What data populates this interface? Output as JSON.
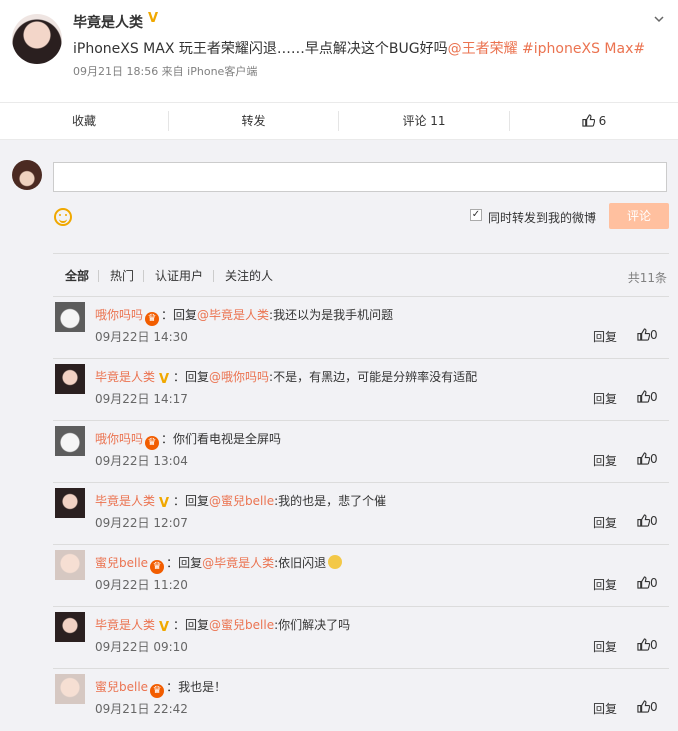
{
  "post": {
    "user": "毕竟是人类",
    "text_before": "iPhoneXS MAX 玩王者荣耀闪退……早点解决这个BUG好吗",
    "mention": "@王者荣耀",
    "topic": "#iphoneXS Max#",
    "meta": "09月21日 18:56 来自 iPhone客户端"
  },
  "actions": {
    "favorite": "收藏",
    "forward": "转发",
    "comment": "评论 11",
    "like": "6"
  },
  "composer": {
    "forward_label": "同时转发到我的微博",
    "submit": "评论",
    "forward_checked": true
  },
  "tabs": {
    "all": "全部",
    "hot": "热门",
    "verified": "认证用户",
    "followed": "关注的人",
    "total": "共11条"
  },
  "comments": [
    {
      "user": "哦你吗吗",
      "prefix": "：回复",
      "mention": "@毕竟是人类",
      "text": ":我还以为是我手机问题",
      "time": "09月22日 14:30",
      "reply": "回复",
      "likes": "0"
    },
    {
      "user": "毕竟是人类",
      "prefix": "：回复",
      "mention": "@哦你吗吗",
      "text": ":不是，有黑边，可能是分辨率没有适配",
      "time": "09月22日 14:17",
      "reply": "回复",
      "likes": "0"
    },
    {
      "user": "哦你吗吗",
      "prefix": "：",
      "mention": "",
      "text": "你们看电视是全屏吗",
      "time": "09月22日 13:04",
      "reply": "回复",
      "likes": "0"
    },
    {
      "user": "毕竟是人类",
      "prefix": "：回复",
      "mention": "@蜜兒belle",
      "text": ":我的也是，悲了个催",
      "time": "09月22日 12:07",
      "reply": "回复",
      "likes": "0"
    },
    {
      "user": "蜜兒belle",
      "prefix": "：回复",
      "mention": "@毕竟是人类",
      "text": ":依旧闪退",
      "time": "09月22日 11:20",
      "reply": "回复",
      "likes": "0"
    },
    {
      "user": "毕竟是人类",
      "prefix": "：回复",
      "mention": "@蜜兒belle",
      "text": ":你们解决了吗",
      "time": "09月22日 09:10",
      "reply": "回复",
      "likes": "0"
    },
    {
      "user": "蜜兒belle",
      "prefix": "：",
      "mention": "",
      "text": "我也是！",
      "time": "09月21日 22:42",
      "reply": "回复",
      "likes": "0"
    }
  ]
}
